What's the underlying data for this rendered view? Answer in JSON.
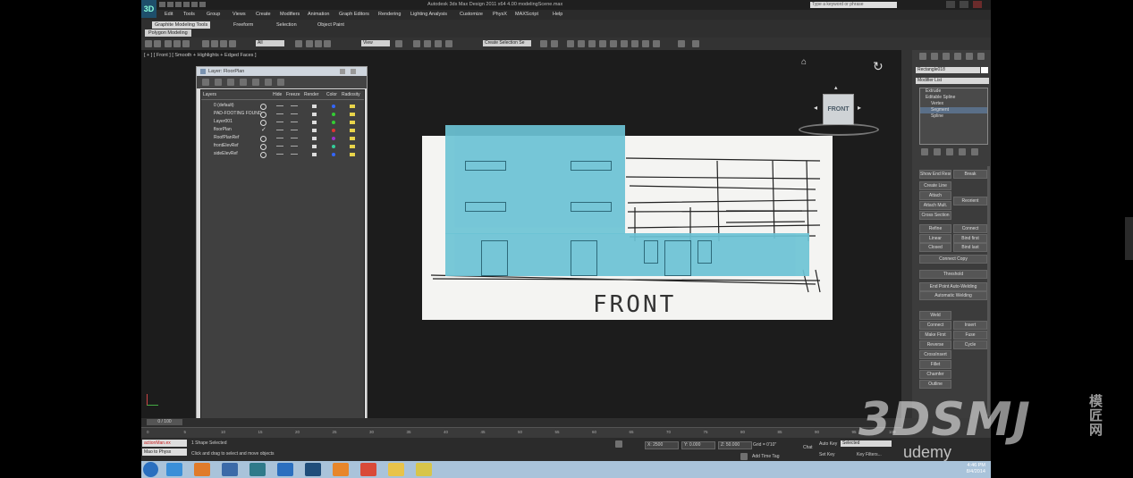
{
  "app": {
    "window_title": "Autodesk 3ds Max Design 2011 x64     4.00 modelingScene.max",
    "search_placeholder": "Type a keyword or phrase",
    "logo": "3D"
  },
  "menu": [
    "Edit",
    "Tools",
    "Group",
    "Views",
    "Create",
    "Modifiers",
    "Animation",
    "Graph Editors",
    "Rendering",
    "Lighting Analysis",
    "Customize",
    "PhysX",
    "MAXScript",
    "Help"
  ],
  "ribbon": {
    "tabs": [
      "Graphite Modeling Tools",
      "Freeform",
      "Selection",
      "Object Paint"
    ],
    "sub_tab": "Polygon Modeling"
  },
  "toolbar": {
    "selection_filter": "All",
    "reference_coord": "View",
    "named_selection": "Create Selection Se"
  },
  "viewport": {
    "label": "[ + ] [ Front ] [ Smooth + Highlights + Edged Faces ]",
    "drawing_text": "FRONT",
    "viewcube_label": "FRONT"
  },
  "layer_dialog": {
    "title": "Layer: FloorPlan",
    "columns": [
      "Layers",
      "Hide",
      "Freeze",
      "Render",
      "Color",
      "Radiosity"
    ],
    "rows": [
      {
        "name": "0 (default)",
        "color": "#3366ff"
      },
      {
        "name": "PAD-FOOTING FOUND",
        "color": "#33cc33"
      },
      {
        "name": "Layer001",
        "color": "#33cc33"
      },
      {
        "name": "floorPlan",
        "color": "#dd3333"
      },
      {
        "name": "RoofPlanRef",
        "color": "#9933cc"
      },
      {
        "name": "frontElevRef",
        "color": "#33cc99"
      },
      {
        "name": "sideElevRef",
        "color": "#3366ff"
      }
    ],
    "checked_row": "floorPlan"
  },
  "command_panel": {
    "object_name": "Rectangle018",
    "modifier_list": "Modifier List",
    "stack": [
      {
        "label": "Extrude",
        "selected": false
      },
      {
        "label": "Editable Spline",
        "selected": false
      },
      {
        "label": "Vertex",
        "selected": false
      },
      {
        "label": "Segment",
        "selected": true
      },
      {
        "label": "Spline",
        "selected": false
      }
    ],
    "buttons": {
      "show_end": "Show End Result",
      "create_line": "Create Line",
      "break": "Break",
      "attach": "Attach",
      "reorient": "Reorient",
      "attach_mult": "Attach Mult.",
      "cross_section": "Cross Section",
      "refine": "Refine",
      "connect": "Connect",
      "linear": "Linear",
      "bind_first": "Bind first",
      "closed": "Closed",
      "bind_last": "Bind last",
      "connect_copy": "Connect Copy",
      "threshold": "Threshold",
      "end_point_auto_welding": "End Point Auto-Welding",
      "automatic_welding": "Automatic Welding",
      "weld": "Weld",
      "connect2": "Connect",
      "insert": "Insert",
      "make_first": "Make First",
      "fuse": "Fuse",
      "reverse": "Reverse",
      "cycle": "Cycle",
      "crossinsert": "CrossInsert",
      "fillet": "Fillet",
      "chamfer": "Chamfer",
      "outline": "Outline"
    }
  },
  "timeline": {
    "frame": "0 / 100",
    "ticks": [
      "0",
      "5",
      "10",
      "15",
      "20",
      "25",
      "30",
      "35",
      "40",
      "45",
      "50",
      "55",
      "60",
      "65",
      "70",
      "75",
      "80",
      "85",
      "90",
      "95",
      "100"
    ]
  },
  "status": {
    "maxscript_line1": "actionMan.ex",
    "maxscript_line2": "Mao to Physx",
    "selection": "1 Shape Selected",
    "prompt": "Click and drag to select and move objects",
    "x": "X: 2500",
    "y": "Y: 0.000",
    "z": "Z: 50.000",
    "grid": "Grid = 0'10\"",
    "auto_key": "Auto Key",
    "selected": "Selected",
    "set_key": "Set Key",
    "key_filters": "Key Filters...",
    "add_time_tag": "Add Time Tag",
    "chat": "Chat"
  },
  "taskbar": {
    "time": "4:46 PM",
    "date": "8/4/2014",
    "icons": [
      {
        "name": "ie-icon",
        "color": "#3a8fd8"
      },
      {
        "name": "firefox-icon",
        "color": "#e07b2a"
      },
      {
        "name": "mail-icon",
        "color": "#3b6aa8"
      },
      {
        "name": "3dsmax-icon",
        "color": "#2f7a8a"
      },
      {
        "name": "globe-icon",
        "color": "#2b6fbf"
      },
      {
        "name": "photoshop-icon",
        "color": "#1f4d7a"
      },
      {
        "name": "media-icon",
        "color": "#e7862a"
      },
      {
        "name": "chrome-icon",
        "color": "#d94a38"
      },
      {
        "name": "folder-icon",
        "color": "#e8c34a"
      },
      {
        "name": "notes-icon",
        "color": "#d7c54a"
      }
    ]
  },
  "watermark": {
    "brand": "3DSMJ",
    "cn": "模匠网",
    "udemy": "udemy"
  }
}
